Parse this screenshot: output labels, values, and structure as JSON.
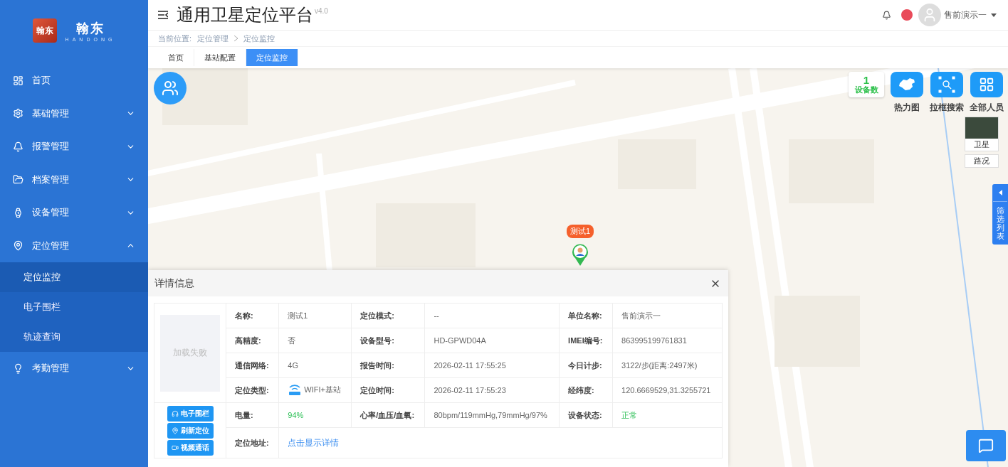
{
  "brand": {
    "logo_mark": "翰东",
    "name": "翰东",
    "subtitle": "HANDONG"
  },
  "sidebar": {
    "items": [
      {
        "label": "首页"
      },
      {
        "label": "基础管理",
        "expanded": false
      },
      {
        "label": "报警管理",
        "expanded": false
      },
      {
        "label": "档案管理",
        "expanded": false
      },
      {
        "label": "设备管理",
        "expanded": false
      },
      {
        "label": "定位管理",
        "expanded": true,
        "children": [
          {
            "label": "定位监控",
            "selected": true
          },
          {
            "label": "电子围栏",
            "selected": false
          },
          {
            "label": "轨迹查询",
            "selected": false
          }
        ]
      },
      {
        "label": "考勤管理",
        "expanded": false
      }
    ]
  },
  "header": {
    "title": "通用卫星定位平台",
    "version": "v4.0",
    "user": "售前演示一"
  },
  "breadcrumb": {
    "prefix": "当前位置:",
    "items": [
      "定位管理",
      "定位监控"
    ]
  },
  "tabs": [
    {
      "label": "首页",
      "selected": false
    },
    {
      "label": "基站配置",
      "selected": false
    },
    {
      "label": "定位监控",
      "selected": true
    }
  ],
  "map": {
    "device_count": "1",
    "device_count_label": "设备数",
    "tools": [
      "热力图",
      "拉框搜索",
      "全部人员"
    ],
    "layers": [
      {
        "label": "卫星",
        "kind": "thumb"
      },
      {
        "label": "路况",
        "kind": "plain"
      }
    ],
    "marker": {
      "label": "测试1"
    },
    "filter_tab": "筛选列表"
  },
  "detail": {
    "title": "详情信息",
    "photo_text": "加载失败",
    "actions": [
      "电子围栏",
      "刷新定位",
      "视频通话"
    ],
    "rows": [
      [
        {
          "label": "名称:",
          "value": "测试1"
        },
        {
          "label": "定位模式:",
          "value": "--"
        },
        {
          "label": "单位名称:",
          "value": "售前演示一"
        }
      ],
      [
        {
          "label": "高精度:",
          "value": "否"
        },
        {
          "label": "设备型号:",
          "value": "HD-GPWD04A"
        },
        {
          "label": "IMEI编号:",
          "value": "863995199761831"
        }
      ],
      [
        {
          "label": "通信网络:",
          "value": "4G"
        },
        {
          "label": "报告时间:",
          "value": "2026-02-11 17:55:25"
        },
        {
          "label": "今日计步:",
          "value": "3122/步(距离:2497米)"
        }
      ],
      [
        {
          "label": "定位类型:",
          "value": "WIFI+基站",
          "kind": "wifi"
        },
        {
          "label": "定位时间:",
          "value": "2026-02-11 17:55:23"
        },
        {
          "label": "经纬度:",
          "value": "120.6669529,31.3255721"
        }
      ],
      [
        {
          "label": "电量:",
          "value": "94%",
          "kind": "good"
        },
        {
          "label": "心率/血压/血氧:",
          "value": "80bpm/119mmHg,79mmHg/97%"
        },
        {
          "label": "设备状态:",
          "value": "正常",
          "kind": "good"
        }
      ]
    ],
    "address": {
      "label": "定位地址:",
      "link": "点击显示详情"
    }
  }
}
